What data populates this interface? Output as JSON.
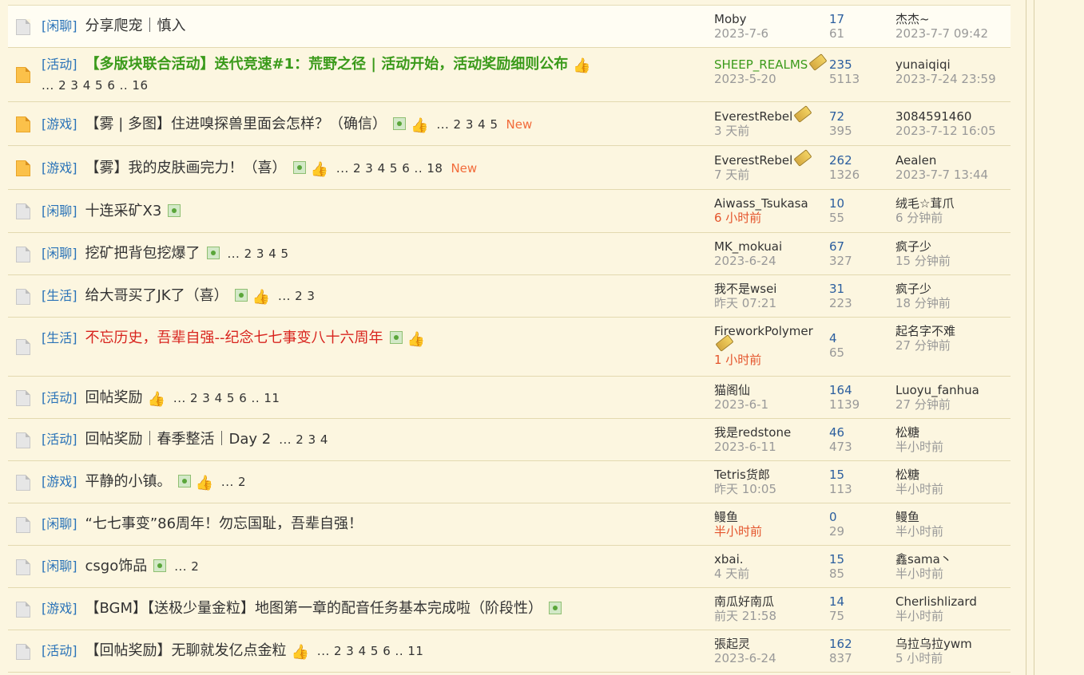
{
  "threads": [
    {
      "type": "[闲聊]",
      "subject": "分享爬宠｜慎入",
      "style": "normal",
      "icon": "normal",
      "has_pic": false,
      "has_thumb": false,
      "pages": "",
      "new": "",
      "author": "Moby",
      "author_style": "normal",
      "author_badge": false,
      "date": "2023-7-6",
      "date_style": "normal",
      "replies": "17",
      "views": "61",
      "last_user": "杰杰~",
      "last_time": "2023-7-7 09:42"
    },
    {
      "type": "[活动]",
      "subject": "【多版块联合活动】迭代竞速#1：荒野之径 | 活动开始，活动奖励细则公布",
      "style": "green",
      "icon": "hot",
      "has_pic": false,
      "has_thumb": true,
      "pages": "... 2 3 4 5 6 .. 16",
      "new": "",
      "author": "SHEEP_REALMS",
      "author_style": "green",
      "author_badge": true,
      "date": "2023-5-20",
      "date_style": "normal",
      "replies": "235",
      "views": "5113",
      "last_user": "yunaiqiqi",
      "last_time": "2023-7-24 23:59"
    },
    {
      "type": "[游戏]",
      "subject": "【雾 | 多图】住进嗅探兽里面会怎样？（确信）",
      "style": "normal",
      "icon": "hot",
      "has_pic": true,
      "has_thumb": true,
      "pages": "... 2 3 4 5",
      "new": "New",
      "author": "EverestRebel",
      "author_style": "normal",
      "author_badge": true,
      "date": "3 天前",
      "date_style": "normal",
      "replies": "72",
      "views": "395",
      "last_user": "3084591460",
      "last_time": "2023-7-12 16:05"
    },
    {
      "type": "[游戏]",
      "subject": "【雾】我的皮肤画完力！（喜）",
      "style": "normal",
      "icon": "hot",
      "has_pic": true,
      "has_thumb": true,
      "pages": "... 2 3 4 5 6 .. 18",
      "new": "New",
      "author": "EverestRebel",
      "author_style": "normal",
      "author_badge": true,
      "date": "7 天前",
      "date_style": "normal",
      "replies": "262",
      "views": "1326",
      "last_user": "Aealen",
      "last_time": "2023-7-7 13:44"
    },
    {
      "type": "[闲聊]",
      "subject": "十连采矿X3",
      "style": "normal",
      "icon": "normal",
      "has_pic": true,
      "has_thumb": false,
      "pages": "",
      "new": "",
      "author": "Aiwass_Tsukasa",
      "author_style": "normal",
      "author_badge": false,
      "date": "6 小时前",
      "date_style": "red",
      "replies": "10",
      "views": "55",
      "last_user": "绒毛☆茸爪",
      "last_time": "6 分钟前"
    },
    {
      "type": "[闲聊]",
      "subject": "挖矿把背包挖爆了",
      "style": "normal",
      "icon": "normal",
      "has_pic": true,
      "has_thumb": false,
      "pages": "... 2 3 4 5",
      "new": "",
      "author": "MK_mokuai",
      "author_style": "normal",
      "author_badge": false,
      "date": "2023-6-24",
      "date_style": "normal",
      "replies": "67",
      "views": "327",
      "last_user": "疯子少",
      "last_time": "15 分钟前"
    },
    {
      "type": "[生活]",
      "subject": "给大哥买了JK了（喜）",
      "style": "normal",
      "icon": "normal",
      "has_pic": true,
      "has_thumb": true,
      "pages": "... 2 3",
      "new": "",
      "author": "我不是wsei",
      "author_style": "normal",
      "author_badge": false,
      "date": "昨天 07:21",
      "date_style": "normal",
      "replies": "31",
      "views": "223",
      "last_user": "疯子少",
      "last_time": "18 分钟前"
    },
    {
      "type": "[生活]",
      "subject": "不忘历史，吾辈自强--纪念七七事变八十六周年",
      "style": "red",
      "icon": "normal",
      "has_pic": true,
      "has_thumb": true,
      "pages": "",
      "new": "",
      "author": "FireworkPolymer",
      "author_style": "normal",
      "author_badge": true,
      "date": "1 小时前",
      "date_style": "red",
      "replies": "4",
      "views": "65",
      "last_user": "起名字不难",
      "last_time": "27 分钟前"
    },
    {
      "type": "[活动]",
      "subject": "回帖奖励",
      "style": "normal",
      "icon": "normal",
      "has_pic": false,
      "has_thumb": true,
      "pages": "... 2 3 4 5 6 .. 11",
      "new": "",
      "author": "猫阁仙",
      "author_style": "normal",
      "author_badge": false,
      "date": "2023-6-1",
      "date_style": "normal",
      "replies": "164",
      "views": "1139",
      "last_user": "Luoyu_fanhua",
      "last_time": "27 分钟前"
    },
    {
      "type": "[活动]",
      "subject": "回帖奖励｜春季整活｜Day 2",
      "style": "normal",
      "icon": "normal",
      "has_pic": false,
      "has_thumb": false,
      "pages": "... 2 3 4",
      "new": "",
      "author": "我是redstone",
      "author_style": "normal",
      "author_badge": false,
      "date": "2023-6-11",
      "date_style": "normal",
      "replies": "46",
      "views": "473",
      "last_user": "松糖",
      "last_time": "半小时前"
    },
    {
      "type": "[游戏]",
      "subject": "平静的小镇。",
      "style": "normal",
      "icon": "normal",
      "has_pic": true,
      "has_thumb": true,
      "pages": "... 2",
      "new": "",
      "author": "Tetris货郎",
      "author_style": "normal",
      "author_badge": false,
      "date": "昨天 10:05",
      "date_style": "normal",
      "replies": "15",
      "views": "113",
      "last_user": "松糖",
      "last_time": "半小时前"
    },
    {
      "type": "[闲聊]",
      "subject": "“七七事变”86周年！勿忘国耻，吾辈自强！",
      "style": "normal",
      "icon": "normal",
      "has_pic": false,
      "has_thumb": false,
      "pages": "",
      "new": "",
      "author": "鳗鱼",
      "author_style": "normal",
      "author_badge": false,
      "date": "半小时前",
      "date_style": "red",
      "replies": "0",
      "views": "29",
      "last_user": "鳗鱼",
      "last_time": "半小时前"
    },
    {
      "type": "[闲聊]",
      "subject": "csgo饰品",
      "style": "normal",
      "icon": "normal",
      "has_pic": true,
      "has_thumb": false,
      "pages": "... 2",
      "new": "",
      "author": "xbai.",
      "author_style": "normal",
      "author_badge": false,
      "date": "4 天前",
      "date_style": "normal",
      "replies": "15",
      "views": "85",
      "last_user": "鑫sama丶",
      "last_time": "半小时前"
    },
    {
      "type": "[游戏]",
      "subject": "【BGM】【送极少量金粒】地图第一章的配音任务基本完成啦（阶段性）",
      "style": "normal",
      "icon": "normal",
      "has_pic": true,
      "has_thumb": false,
      "pages": "",
      "new": "",
      "author": "南瓜好南瓜",
      "author_style": "normal",
      "author_badge": false,
      "date": "前天 21:58",
      "date_style": "normal",
      "replies": "14",
      "views": "75",
      "last_user": "Cherlishlizard",
      "last_time": "半小时前"
    },
    {
      "type": "[活动]",
      "subject": "【回帖奖励】无聊就发亿点金粒",
      "style": "normal",
      "icon": "normal",
      "has_pic": false,
      "has_thumb": true,
      "pages": "... 2 3 4 5 6 .. 11",
      "new": "",
      "author": "張起灵",
      "author_style": "normal",
      "author_badge": false,
      "date": "2023-6-24",
      "date_style": "normal",
      "replies": "162",
      "views": "837",
      "last_user": "乌拉乌拉ywm",
      "last_time": "5 小时前"
    }
  ]
}
